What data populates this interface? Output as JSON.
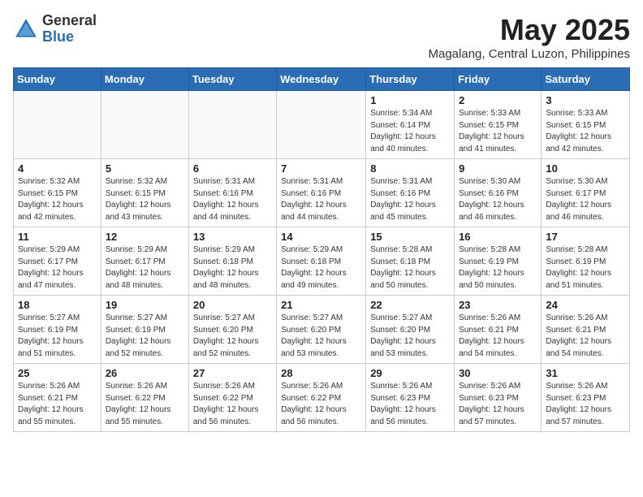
{
  "header": {
    "logo_general": "General",
    "logo_blue": "Blue",
    "month_title": "May 2025",
    "location": "Magalang, Central Luzon, Philippines"
  },
  "weekdays": [
    "Sunday",
    "Monday",
    "Tuesday",
    "Wednesday",
    "Thursday",
    "Friday",
    "Saturday"
  ],
  "weeks": [
    [
      {
        "day": "",
        "info": ""
      },
      {
        "day": "",
        "info": ""
      },
      {
        "day": "",
        "info": ""
      },
      {
        "day": "",
        "info": ""
      },
      {
        "day": "1",
        "info": "Sunrise: 5:34 AM\nSunset: 6:14 PM\nDaylight: 12 hours\nand 40 minutes."
      },
      {
        "day": "2",
        "info": "Sunrise: 5:33 AM\nSunset: 6:15 PM\nDaylight: 12 hours\nand 41 minutes."
      },
      {
        "day": "3",
        "info": "Sunrise: 5:33 AM\nSunset: 6:15 PM\nDaylight: 12 hours\nand 42 minutes."
      }
    ],
    [
      {
        "day": "4",
        "info": "Sunrise: 5:32 AM\nSunset: 6:15 PM\nDaylight: 12 hours\nand 42 minutes."
      },
      {
        "day": "5",
        "info": "Sunrise: 5:32 AM\nSunset: 6:15 PM\nDaylight: 12 hours\nand 43 minutes."
      },
      {
        "day": "6",
        "info": "Sunrise: 5:31 AM\nSunset: 6:16 PM\nDaylight: 12 hours\nand 44 minutes."
      },
      {
        "day": "7",
        "info": "Sunrise: 5:31 AM\nSunset: 6:16 PM\nDaylight: 12 hours\nand 44 minutes."
      },
      {
        "day": "8",
        "info": "Sunrise: 5:31 AM\nSunset: 6:16 PM\nDaylight: 12 hours\nand 45 minutes."
      },
      {
        "day": "9",
        "info": "Sunrise: 5:30 AM\nSunset: 6:16 PM\nDaylight: 12 hours\nand 46 minutes."
      },
      {
        "day": "10",
        "info": "Sunrise: 5:30 AM\nSunset: 6:17 PM\nDaylight: 12 hours\nand 46 minutes."
      }
    ],
    [
      {
        "day": "11",
        "info": "Sunrise: 5:29 AM\nSunset: 6:17 PM\nDaylight: 12 hours\nand 47 minutes."
      },
      {
        "day": "12",
        "info": "Sunrise: 5:29 AM\nSunset: 6:17 PM\nDaylight: 12 hours\nand 48 minutes."
      },
      {
        "day": "13",
        "info": "Sunrise: 5:29 AM\nSunset: 6:18 PM\nDaylight: 12 hours\nand 48 minutes."
      },
      {
        "day": "14",
        "info": "Sunrise: 5:29 AM\nSunset: 6:18 PM\nDaylight: 12 hours\nand 49 minutes."
      },
      {
        "day": "15",
        "info": "Sunrise: 5:28 AM\nSunset: 6:18 PM\nDaylight: 12 hours\nand 50 minutes."
      },
      {
        "day": "16",
        "info": "Sunrise: 5:28 AM\nSunset: 6:19 PM\nDaylight: 12 hours\nand 50 minutes."
      },
      {
        "day": "17",
        "info": "Sunrise: 5:28 AM\nSunset: 6:19 PM\nDaylight: 12 hours\nand 51 minutes."
      }
    ],
    [
      {
        "day": "18",
        "info": "Sunrise: 5:27 AM\nSunset: 6:19 PM\nDaylight: 12 hours\nand 51 minutes."
      },
      {
        "day": "19",
        "info": "Sunrise: 5:27 AM\nSunset: 6:19 PM\nDaylight: 12 hours\nand 52 minutes."
      },
      {
        "day": "20",
        "info": "Sunrise: 5:27 AM\nSunset: 6:20 PM\nDaylight: 12 hours\nand 52 minutes."
      },
      {
        "day": "21",
        "info": "Sunrise: 5:27 AM\nSunset: 6:20 PM\nDaylight: 12 hours\nand 53 minutes."
      },
      {
        "day": "22",
        "info": "Sunrise: 5:27 AM\nSunset: 6:20 PM\nDaylight: 12 hours\nand 53 minutes."
      },
      {
        "day": "23",
        "info": "Sunrise: 5:26 AM\nSunset: 6:21 PM\nDaylight: 12 hours\nand 54 minutes."
      },
      {
        "day": "24",
        "info": "Sunrise: 5:26 AM\nSunset: 6:21 PM\nDaylight: 12 hours\nand 54 minutes."
      }
    ],
    [
      {
        "day": "25",
        "info": "Sunrise: 5:26 AM\nSunset: 6:21 PM\nDaylight: 12 hours\nand 55 minutes."
      },
      {
        "day": "26",
        "info": "Sunrise: 5:26 AM\nSunset: 6:22 PM\nDaylight: 12 hours\nand 55 minutes."
      },
      {
        "day": "27",
        "info": "Sunrise: 5:26 AM\nSunset: 6:22 PM\nDaylight: 12 hours\nand 56 minutes."
      },
      {
        "day": "28",
        "info": "Sunrise: 5:26 AM\nSunset: 6:22 PM\nDaylight: 12 hours\nand 56 minutes."
      },
      {
        "day": "29",
        "info": "Sunrise: 5:26 AM\nSunset: 6:23 PM\nDaylight: 12 hours\nand 56 minutes."
      },
      {
        "day": "30",
        "info": "Sunrise: 5:26 AM\nSunset: 6:23 PM\nDaylight: 12 hours\nand 57 minutes."
      },
      {
        "day": "31",
        "info": "Sunrise: 5:26 AM\nSunset: 6:23 PM\nDaylight: 12 hours\nand 57 minutes."
      }
    ]
  ]
}
